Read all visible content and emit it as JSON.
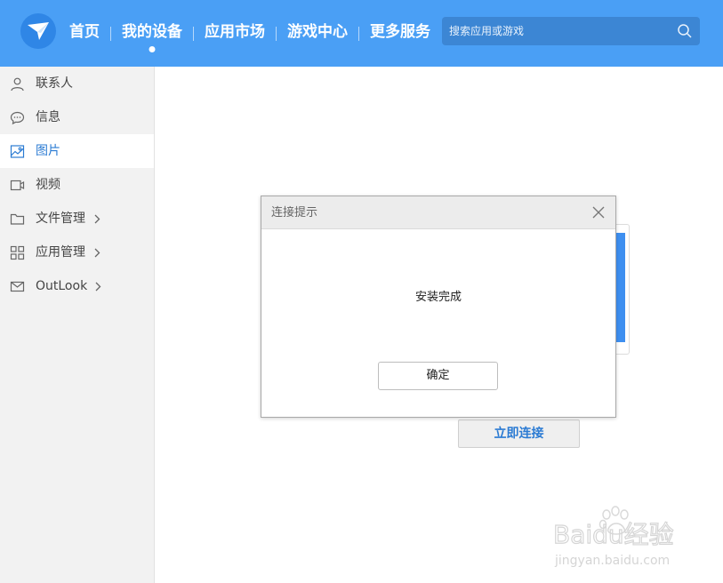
{
  "header": {
    "nav": [
      "首页",
      "我的设备",
      "应用市场",
      "游戏中心",
      "更多服务"
    ],
    "active_nav": "我的设备",
    "search_placeholder": "搜索应用或游戏",
    "background_color": "#4a9ff5"
  },
  "sidebar": {
    "items": [
      {
        "label": "联系人",
        "icon": "person-icon"
      },
      {
        "label": "信息",
        "icon": "message-bubble-icon"
      },
      {
        "label": "图片",
        "icon": "image-icon",
        "active": true
      },
      {
        "label": "视频",
        "icon": "video-icon"
      },
      {
        "label": "文件管理",
        "icon": "folder-icon",
        "expandable": true
      },
      {
        "label": "应用管理",
        "icon": "grid-icon",
        "expandable": true
      },
      {
        "label": "OutLook",
        "icon": "mail-icon",
        "expandable": true
      }
    ]
  },
  "main": {
    "connect_button": "立即连接"
  },
  "dialog": {
    "title": "连接提示",
    "message": "安装完成",
    "ok_button": "确定"
  },
  "watermark": {
    "brand": "Baidu经验",
    "url": "jingyan.baidu.com"
  },
  "colors": {
    "accent": "#2b7bd3",
    "sidebar_bg": "#f2f2f2"
  }
}
